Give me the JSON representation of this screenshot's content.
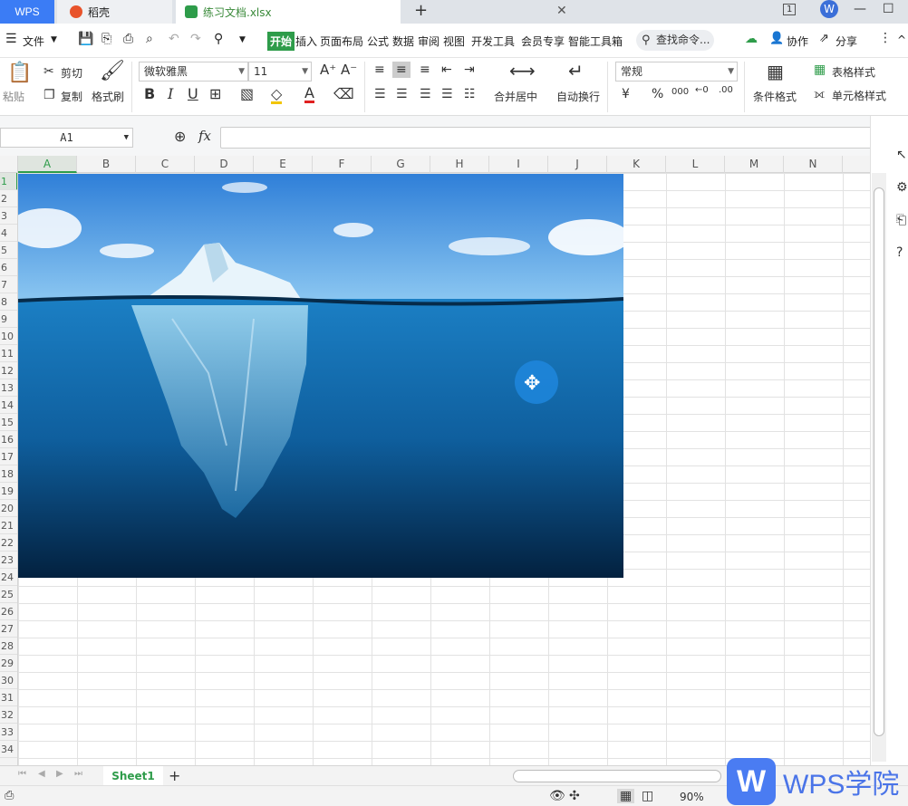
{
  "tabs": {
    "wps": "WPS",
    "daoke": "稻壳",
    "file": "练习文档.xlsx",
    "add": "+",
    "close": "✕"
  },
  "menu": {
    "file": "文件",
    "items": [
      "开始",
      "插入",
      "页面布局",
      "公式",
      "数据",
      "审阅",
      "视图",
      "开发工具",
      "会员专享",
      "智能工具箱"
    ],
    "search": "查找命令...",
    "collab": "协作",
    "share": "分享"
  },
  "ribbon": {
    "paste": "粘贴",
    "cut": "剪切",
    "copy": "复制",
    "format_painter": "格式刷",
    "font_name": "微软雅黑",
    "font_size": "11",
    "bold": "B",
    "italic": "I",
    "underline": "U",
    "merge_center": "合并居中",
    "wrap_text": "自动换行",
    "number_format": "常规",
    "currency": "¥",
    "percent": "%",
    "thousands": "000",
    "cond_format": "条件格式",
    "table_style": "表格样式",
    "cell_style": "单元格样式"
  },
  "formula_bar": {
    "name_box": "A1",
    "fx": "fx",
    "value": ""
  },
  "columns": [
    "A",
    "B",
    "C",
    "D",
    "E",
    "F",
    "G",
    "H",
    "I",
    "J",
    "K",
    "L",
    "M",
    "N"
  ],
  "rows": [
    "1",
    "2",
    "3",
    "4",
    "5",
    "6",
    "7",
    "8",
    "9",
    "10",
    "11",
    "12",
    "13",
    "14",
    "15",
    "16",
    "17",
    "18",
    "19",
    "20",
    "21",
    "22",
    "23",
    "24",
    "25",
    "26",
    "27",
    "28",
    "29",
    "30",
    "31",
    "32",
    "33",
    "34"
  ],
  "sheets": {
    "active": "Sheet1",
    "add": "+"
  },
  "status": {
    "zoom": "90%"
  },
  "watermark": {
    "logo": "W",
    "text": "WPS学院"
  },
  "colors": {
    "accent": "#2e9c4a",
    "wps_blue": "#3b7cf5",
    "sky_top": "#3f8fe0",
    "water": "#0a5a9e"
  }
}
